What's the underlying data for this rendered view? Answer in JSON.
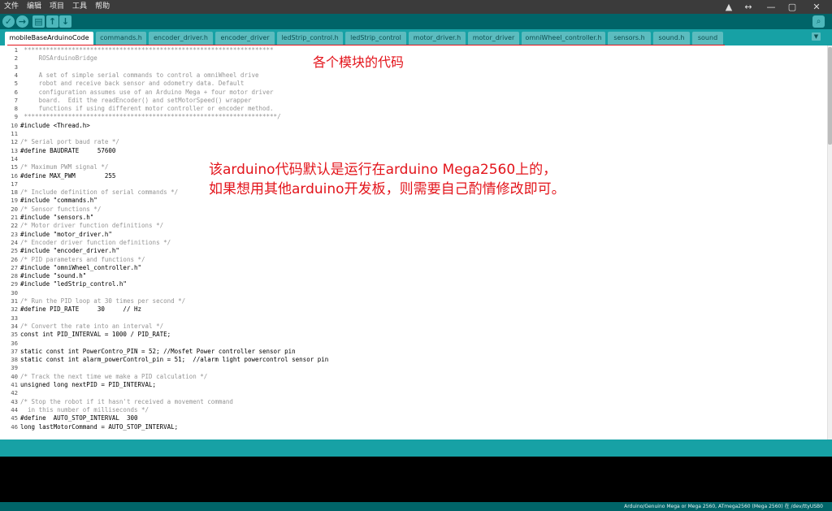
{
  "menubar": {
    "items": [
      "文件",
      "编辑",
      "项目",
      "工具",
      "帮助"
    ],
    "window_controls": [
      "▲",
      "↔",
      "—",
      "▢",
      "✕"
    ]
  },
  "toolbar": {
    "verify_icon": "✓",
    "upload_icon": "→",
    "new_icon": "▤",
    "open_icon": "↑",
    "save_icon": "↓",
    "serial_monitor_icon": "⌕"
  },
  "tabs": [
    {
      "label": "mobileBaseArduinoCode",
      "active": true
    },
    {
      "label": "commands.h"
    },
    {
      "label": "encoder_driver.h"
    },
    {
      "label": "encoder_driver"
    },
    {
      "label": "ledStrip_control.h"
    },
    {
      "label": "ledStrip_control"
    },
    {
      "label": "motor_driver.h"
    },
    {
      "label": "motor_driver"
    },
    {
      "label": "omniWheel_controller.h"
    },
    {
      "label": "sensors.h"
    },
    {
      "label": "sound.h"
    },
    {
      "label": "sound"
    }
  ],
  "tab_menu_icon": "▼",
  "code": [
    {
      "n": "1",
      "t": " ********************************************************************",
      "c": "comment"
    },
    {
      "n": "2",
      "t": "     ROSArduinoBridge",
      "c": "comment"
    },
    {
      "n": "3",
      "t": "",
      "c": "comment"
    },
    {
      "n": "4",
      "t": "     A set of simple serial commands to control a omniWheel drive",
      "c": "comment"
    },
    {
      "n": "5",
      "t": "     robot and receive back sensor and odometry data. Default",
      "c": "comment"
    },
    {
      "n": "6",
      "t": "     configuration assumes use of an Arduino Mega + four motor driver",
      "c": "comment"
    },
    {
      "n": "7",
      "t": "     board.  Edit the readEncoder() and setMotorSpeed() wrapper",
      "c": "comment"
    },
    {
      "n": "8",
      "t": "     functions if using different motor controller or encoder method.",
      "c": "comment"
    },
    {
      "n": "9",
      "t": " *********************************************************************/",
      "c": "comment"
    },
    {
      "n": "10",
      "t": "#include <Thread.h>",
      "c": "pre"
    },
    {
      "n": "11",
      "t": "",
      "c": "pre"
    },
    {
      "n": "12",
      "t": "/* Serial port baud rate */",
      "c": "comment"
    },
    {
      "n": "13",
      "t": "#define BAUDRATE     57600",
      "c": "pre"
    },
    {
      "n": "14",
      "t": "",
      "c": "pre"
    },
    {
      "n": "15",
      "t": "/* Maximum PWM signal */",
      "c": "comment"
    },
    {
      "n": "16",
      "t": "#define MAX_PWM        255",
      "c": "pre"
    },
    {
      "n": "17",
      "t": "",
      "c": "pre"
    },
    {
      "n": "18",
      "t": "/* Include definition of serial commands */",
      "c": "comment"
    },
    {
      "n": "19",
      "t": "#include \"commands.h\"",
      "c": "pre"
    },
    {
      "n": "20",
      "t": "/* Sensor functions */",
      "c": "comment"
    },
    {
      "n": "21",
      "t": "#include \"sensors.h\"",
      "c": "pre"
    },
    {
      "n": "22",
      "t": "/* Motor driver function definitions */",
      "c": "comment"
    },
    {
      "n": "23",
      "t": "#include \"motor_driver.h\"",
      "c": "pre"
    },
    {
      "n": "24",
      "t": "/* Encoder driver function definitions */",
      "c": "comment"
    },
    {
      "n": "25",
      "t": "#include \"encoder_driver.h\"",
      "c": "pre"
    },
    {
      "n": "26",
      "t": "/* PID parameters and functions */",
      "c": "comment"
    },
    {
      "n": "27",
      "t": "#include \"omniWheel_controller.h\"",
      "c": "pre"
    },
    {
      "n": "28",
      "t": "#include \"sound.h\"",
      "c": "pre"
    },
    {
      "n": "29",
      "t": "#include \"ledStrip_control.h\"",
      "c": "pre"
    },
    {
      "n": "30",
      "t": "",
      "c": "pre"
    },
    {
      "n": "31",
      "t": "/* Run the PID loop at 30 times per second */",
      "c": "comment"
    },
    {
      "n": "32",
      "t": "#define PID_RATE     30     // Hz",
      "c": "pre"
    },
    {
      "n": "33",
      "t": "",
      "c": "pre"
    },
    {
      "n": "34",
      "t": "/* Convert the rate into an interval */",
      "c": "comment"
    },
    {
      "n": "35",
      "t": "const int PID_INTERVAL = 1000 / PID_RATE;",
      "c": "pre"
    },
    {
      "n": "36",
      "t": "",
      "c": "pre"
    },
    {
      "n": "37",
      "t": "static const int PowerContro_PIN = 52; //Mosfet Power controller sensor pin",
      "c": "pre"
    },
    {
      "n": "38",
      "t": "static const int alarm_powerControl_pin = 51;  //alarm light powercontrol sensor pin",
      "c": "pre"
    },
    {
      "n": "39",
      "t": "",
      "c": "pre"
    },
    {
      "n": "40",
      "t": "/* Track the next time we make a PID calculation */",
      "c": "comment"
    },
    {
      "n": "41",
      "t": "unsigned long nextPID = PID_INTERVAL;",
      "c": "pre"
    },
    {
      "n": "42",
      "t": "",
      "c": "pre"
    },
    {
      "n": "43",
      "t": "/* Stop the robot if it hasn't received a movement command",
      "c": "comment"
    },
    {
      "n": "44",
      "t": "  in this number of milliseconds */",
      "c": "comment"
    },
    {
      "n": "45",
      "t": "#define  AUTO_STOP_INTERVAL  300",
      "c": "pre"
    },
    {
      "n": "46",
      "t": "long lastMotorCommand = AUTO_STOP_INTERVAL;",
      "c": "pre"
    }
  ],
  "annotations": {
    "modules": "各个模块的代码",
    "board_line1": "该arduino代码默认是运行在arduino Mega2560上的，",
    "board_line2": "如果想用其他arduino开发板，则需要自己酌情修改即可。"
  },
  "footer": {
    "board_info": "Arduino/Genuino Mega or Mega 2560, ATmega2560 (Mega 2560) 在 /dev/ttyUSB0"
  }
}
